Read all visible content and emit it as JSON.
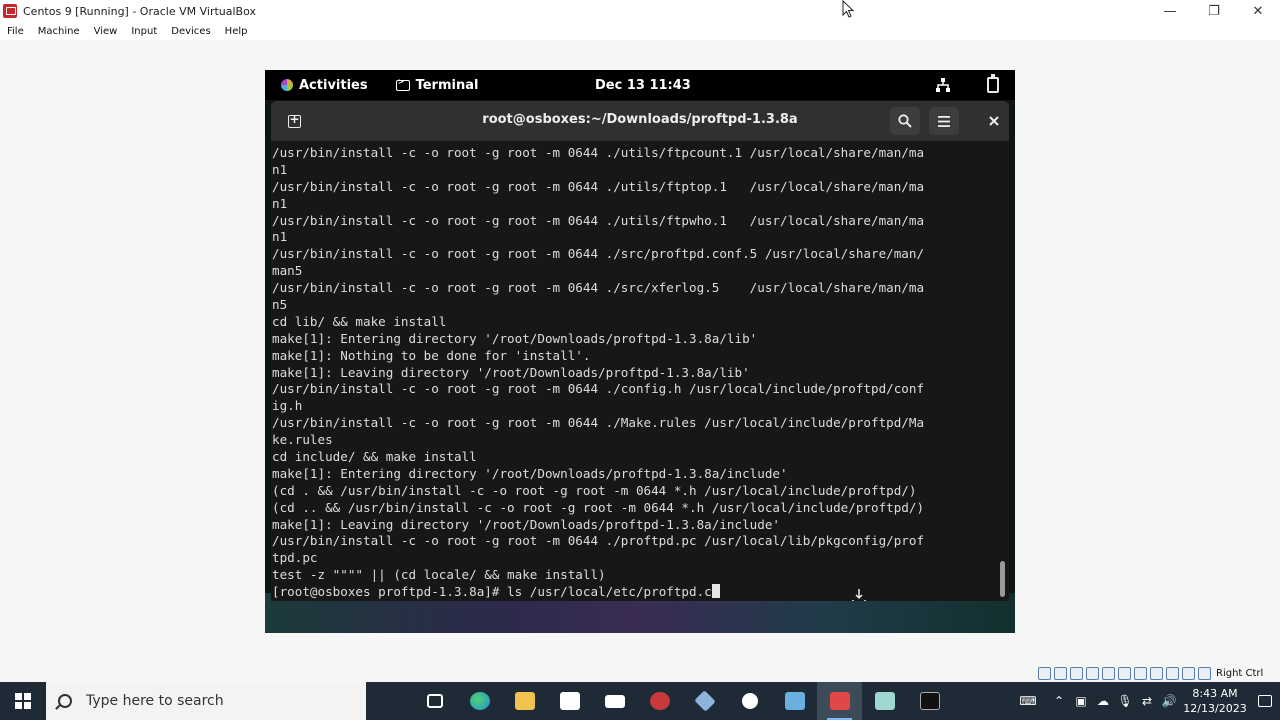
{
  "host_window": {
    "title": "Centos 9 [Running] - Oracle VM VirtualBox",
    "menu": [
      "File",
      "Machine",
      "View",
      "Input",
      "Devices",
      "Help"
    ],
    "controls": {
      "minimize": "—",
      "restore": "❐",
      "close": "✕"
    }
  },
  "gnome": {
    "activities": "Activities",
    "app_name": "Terminal",
    "clock": "Dec 13  11:43"
  },
  "terminal": {
    "title": "root@osboxes:~/Downloads/proftpd-1.3.8a",
    "lines": [
      "/usr/bin/install -c -o root -g root -m 0644 ./utils/ftpcount.1 /usr/local/share/man/ma",
      "n1",
      "/usr/bin/install -c -o root -g root -m 0644 ./utils/ftptop.1   /usr/local/share/man/ma",
      "n1",
      "/usr/bin/install -c -o root -g root -m 0644 ./utils/ftpwho.1   /usr/local/share/man/ma",
      "n1",
      "/usr/bin/install -c -o root -g root -m 0644 ./src/proftpd.conf.5 /usr/local/share/man/",
      "man5",
      "/usr/bin/install -c -o root -g root -m 0644 ./src/xferlog.5    /usr/local/share/man/ma",
      "n5",
      "cd lib/ && make install",
      "make[1]: Entering directory '/root/Downloads/proftpd-1.3.8a/lib'",
      "make[1]: Nothing to be done for 'install'.",
      "make[1]: Leaving directory '/root/Downloads/proftpd-1.3.8a/lib'",
      "/usr/bin/install -c -o root -g root -m 0644 ./config.h /usr/local/include/proftpd/conf",
      "ig.h",
      "/usr/bin/install -c -o root -g root -m 0644 ./Make.rules /usr/local/include/proftpd/Ma",
      "ke.rules",
      "cd include/ && make install",
      "make[1]: Entering directory '/root/Downloads/proftpd-1.3.8a/include'",
      "(cd . && /usr/bin/install -c -o root -g root -m 0644 *.h /usr/local/include/proftpd/)",
      "(cd .. && /usr/bin/install -c -o root -g root -m 0644 *.h /usr/local/include/proftpd/)",
      "make[1]: Leaving directory '/root/Downloads/proftpd-1.3.8a/include'",
      "/usr/bin/install -c -o root -g root -m 0644 ./proftpd.pc /usr/local/lib/pkgconfig/prof",
      "tpd.pc",
      "test -z \"\"\"\" || (cd locale/ && make install)"
    ],
    "prompt": "[root@osboxes proftpd-1.3.8a]# ",
    "command": "ls /usr/local/etc/proftpd.c"
  },
  "vbox_status": {
    "host_key": "Right Ctrl"
  },
  "taskbar": {
    "search_placeholder": "Type here to search",
    "time": "8:43 AM",
    "date": "12/13/2023"
  },
  "colors": {
    "taskbar": "#1e2a35",
    "terminal_bg": "#171717",
    "terminal_header": "#303030",
    "gnome_bar": "#000000"
  }
}
